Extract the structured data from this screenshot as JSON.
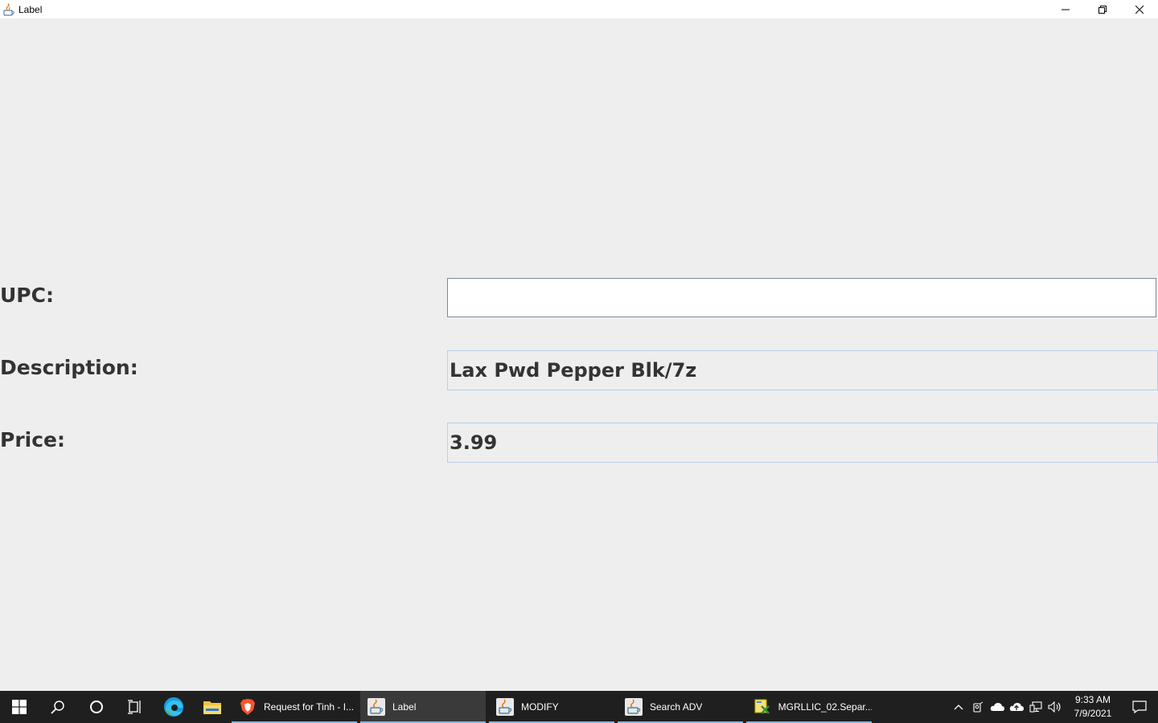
{
  "window": {
    "title": "Label",
    "controls": [
      "minimize",
      "restore",
      "close"
    ]
  },
  "form": {
    "upc_label": "UPC:",
    "upc_value": "",
    "description_label": "Description:",
    "description_value": "Lax Pwd Pepper Blk/7z",
    "price_label": "Price:",
    "price_value": "3.99"
  },
  "taskbar": {
    "pinned": [
      "windows-start-icon",
      "search-icon",
      "cortana-icon",
      "task-view-icon",
      "edge-icon",
      "file-explorer-icon"
    ],
    "apps": [
      {
        "label": "Request for Tinh - I...",
        "icon": "brave-icon",
        "active": false
      },
      {
        "label": "Label",
        "icon": "java-icon",
        "active": true
      },
      {
        "label": "MODIFY",
        "icon": "java-icon",
        "active": false
      },
      {
        "label": "Search ADV",
        "icon": "java-icon",
        "active": false
      },
      {
        "label": "MGRLLIC_02.Separ...",
        "icon": "sql-tool-icon",
        "active": false
      }
    ],
    "clock_time": "9:33 AM",
    "clock_date": "7/9/2021"
  }
}
